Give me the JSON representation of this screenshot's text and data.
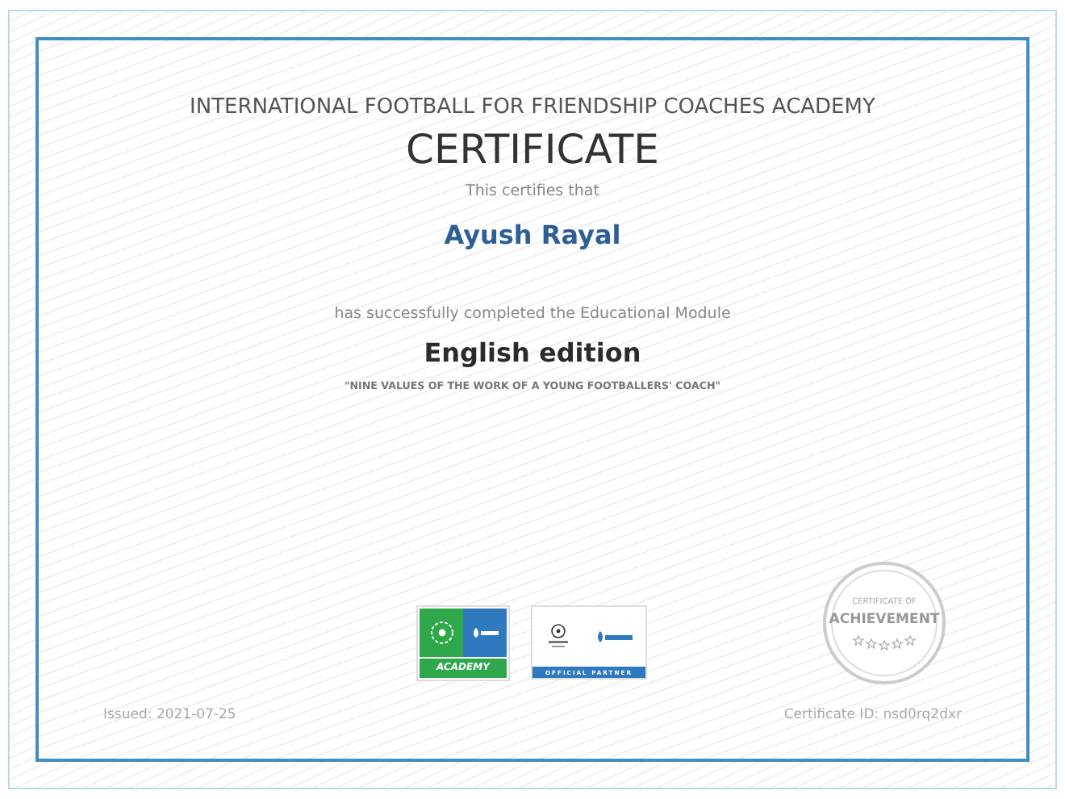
{
  "certificate": {
    "organization": "INTERNATIONAL FOOTBALL FOR FRIENDSHIP COACHES ACADEMY",
    "title": "CERTIFICATE",
    "intro": "This certifies that",
    "recipient": "Ayush Rayal",
    "completion_text": "has successfully completed the Educational Module",
    "module": "English edition",
    "module_subtitle": "\"NINE VALUES OF THE WORK OF A YOUNG FOOTBALLERS' COACH\"",
    "logos": [
      {
        "kind": "academy",
        "label": "ACADEMY"
      },
      {
        "kind": "partner",
        "label": "OFFICIAL PARTNER"
      }
    ],
    "seal": {
      "top": "CERTIFICATE OF",
      "main": "ACHIEVEMENT"
    },
    "issued": "Issued: 2021-07-25",
    "certificate_id": "Certificate ID: nsd0rq2dxr"
  }
}
